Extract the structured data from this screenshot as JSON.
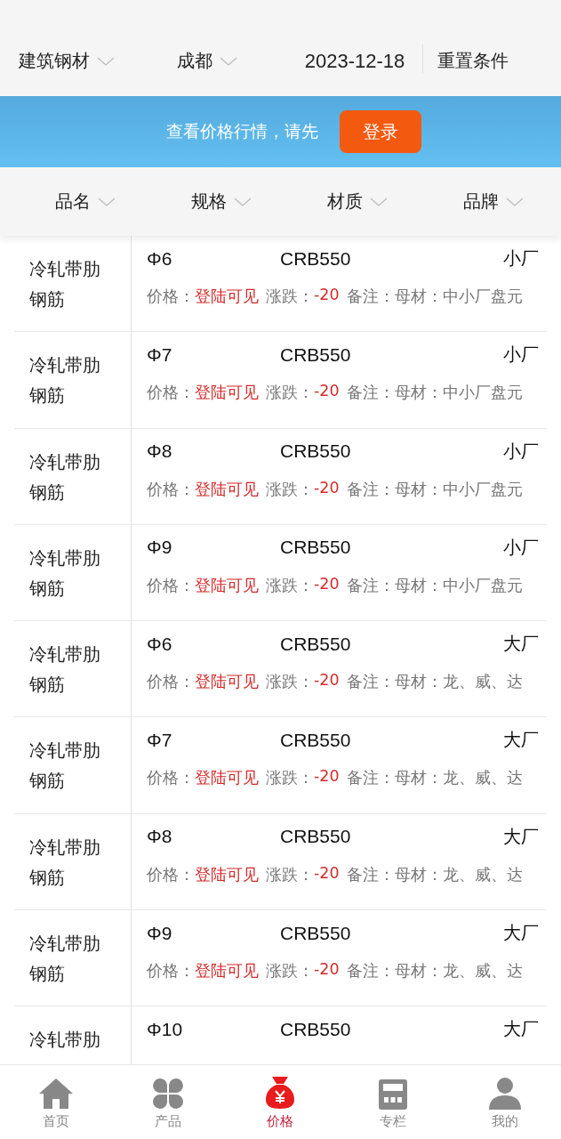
{
  "filters": {
    "category": "建筑钢材",
    "city": "成都",
    "date": "2023-12-18",
    "reset": "重置条件"
  },
  "banner": {
    "text": "查看价格行情，请先",
    "button": "登录"
  },
  "columns": [
    "品名",
    "规格",
    "材质",
    "品牌"
  ],
  "rows": [
    {
      "name": "冷轧带肋钢筋",
      "spec": "Φ6",
      "material": "CRB550",
      "brand": "小厂",
      "price_label": "价格：",
      "price": "登陆可见",
      "change_label": "涨跌：",
      "change": "-20",
      "remark": "备注：母材：中小厂盘元"
    },
    {
      "name": "冷轧带肋钢筋",
      "spec": "Φ7",
      "material": "CRB550",
      "brand": "小厂",
      "price_label": "价格：",
      "price": "登陆可见",
      "change_label": "涨跌：",
      "change": "-20",
      "remark": "备注：母材：中小厂盘元"
    },
    {
      "name": "冷轧带肋钢筋",
      "spec": "Φ8",
      "material": "CRB550",
      "brand": "小厂",
      "price_label": "价格：",
      "price": "登陆可见",
      "change_label": "涨跌：",
      "change": "-20",
      "remark": "备注：母材：中小厂盘元"
    },
    {
      "name": "冷轧带肋钢筋",
      "spec": "Φ9",
      "material": "CRB550",
      "brand": "小厂",
      "price_label": "价格：",
      "price": "登陆可见",
      "change_label": "涨跌：",
      "change": "-20",
      "remark": "备注：母材：中小厂盘元"
    },
    {
      "name": "冷轧带肋钢筋",
      "spec": "Φ6",
      "material": "CRB550",
      "brand": "大厂",
      "price_label": "价格：",
      "price": "登陆可见",
      "change_label": "涨跌：",
      "change": "-20",
      "remark": "备注：母材：龙、威、达"
    },
    {
      "name": "冷轧带肋钢筋",
      "spec": "Φ7",
      "material": "CRB550",
      "brand": "大厂",
      "price_label": "价格：",
      "price": "登陆可见",
      "change_label": "涨跌：",
      "change": "-20",
      "remark": "备注：母材：龙、威、达"
    },
    {
      "name": "冷轧带肋钢筋",
      "spec": "Φ8",
      "material": "CRB550",
      "brand": "大厂",
      "price_label": "价格：",
      "price": "登陆可见",
      "change_label": "涨跌：",
      "change": "-20",
      "remark": "备注：母材：龙、威、达"
    },
    {
      "name": "冷轧带肋钢筋",
      "spec": "Φ9",
      "material": "CRB550",
      "brand": "大厂",
      "price_label": "价格：",
      "price": "登陆可见",
      "change_label": "涨跌：",
      "change": "-20",
      "remark": "备注：母材：龙、威、达"
    },
    {
      "name": "冷轧带肋",
      "spec": "Φ10",
      "material": "CRB550",
      "brand": "大厂"
    }
  ],
  "nav": [
    {
      "label": "首页",
      "selected": false
    },
    {
      "label": "产品",
      "selected": false
    },
    {
      "label": "价格",
      "selected": true
    },
    {
      "label": "专栏",
      "selected": false
    },
    {
      "label": "我的",
      "selected": false
    }
  ]
}
